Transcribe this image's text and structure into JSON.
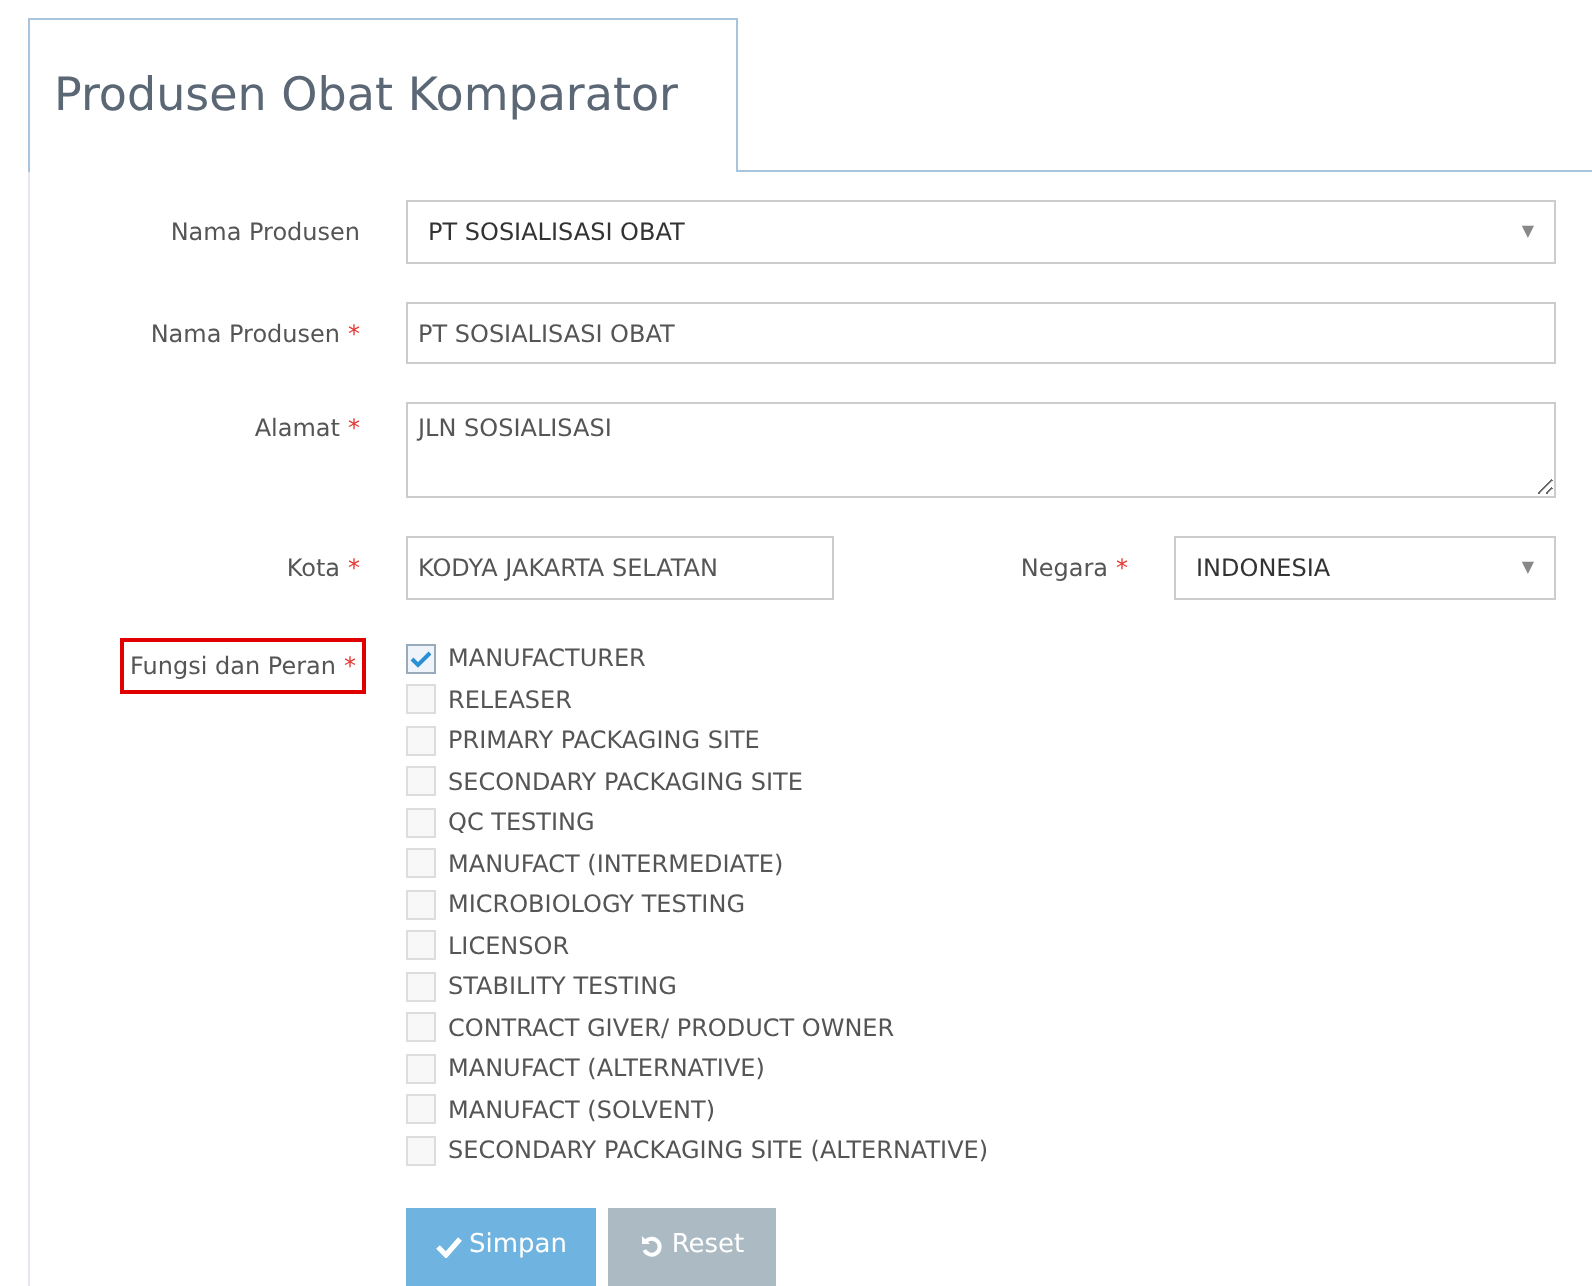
{
  "tab": {
    "title": "Produsen Obat Komparator"
  },
  "producer_select": {
    "label": "Nama Produsen",
    "value": "PT SOSIALISASI OBAT",
    "caret": "▼"
  },
  "producer_name": {
    "label": "Nama Produsen",
    "required_mark": "*",
    "value": "PT SOSIALISASI OBAT"
  },
  "address": {
    "label": "Alamat",
    "required_mark": "*",
    "value": "JLN SOSIALISASI"
  },
  "city": {
    "label": "Kota",
    "required_mark": "*",
    "value": "KODYA JAKARTA SELATAN"
  },
  "country": {
    "label": "Negara",
    "required_mark": "*",
    "value": "INDONESIA",
    "caret": "▼"
  },
  "roles": {
    "label": "Fungsi dan Peran",
    "required_mark": "*",
    "highlighted": true,
    "options": [
      {
        "label": "MANUFACTURER",
        "checked": true
      },
      {
        "label": "RELEASER",
        "checked": false
      },
      {
        "label": "PRIMARY PACKAGING SITE",
        "checked": false
      },
      {
        "label": "SECONDARY PACKAGING SITE",
        "checked": false
      },
      {
        "label": "QC TESTING",
        "checked": false
      },
      {
        "label": "MANUFACT (INTERMEDIATE)",
        "checked": false
      },
      {
        "label": "MICROBIOLOGY TESTING",
        "checked": false
      },
      {
        "label": "LICENSOR",
        "checked": false
      },
      {
        "label": "STABILITY TESTING",
        "checked": false
      },
      {
        "label": "CONTRACT GIVER/ PRODUCT OWNER",
        "checked": false
      },
      {
        "label": "MANUFACT (ALTERNATIVE)",
        "checked": false
      },
      {
        "label": "MANUFACT (SOLVENT)",
        "checked": false
      },
      {
        "label": "SECONDARY PACKAGING SITE (ALTERNATIVE)",
        "checked": false
      }
    ]
  },
  "buttons": [
    {
      "label": "Simpan",
      "kind": "save"
    },
    {
      "label": "Reset",
      "kind": "reset"
    }
  ]
}
